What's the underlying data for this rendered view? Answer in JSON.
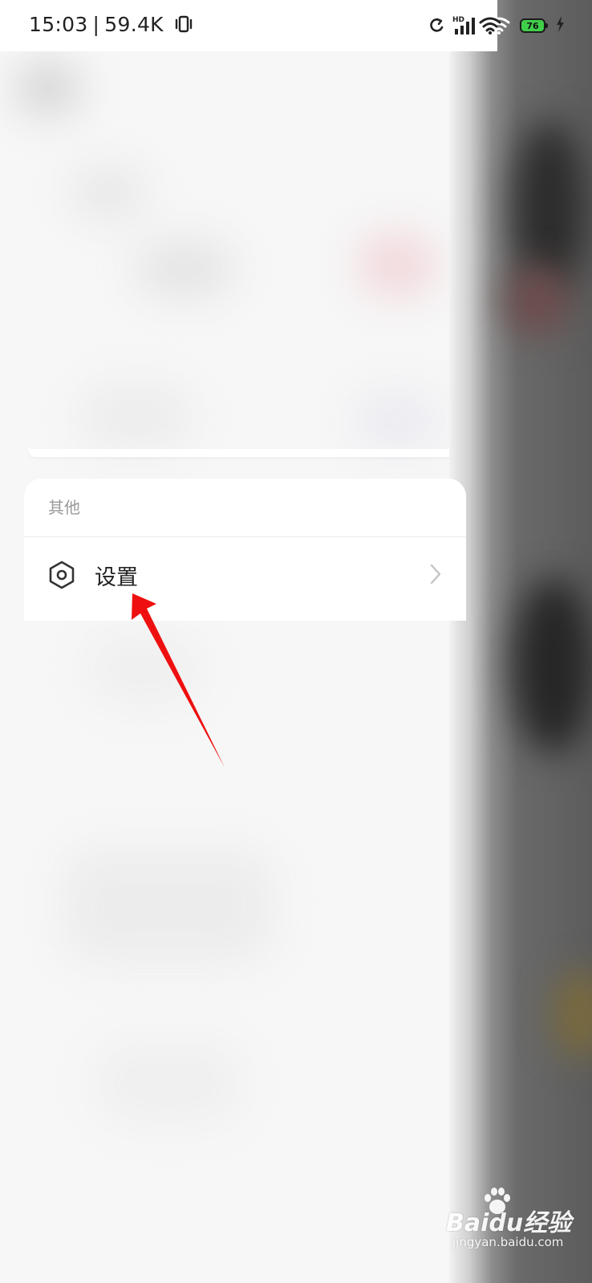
{
  "status_bar": {
    "time": "15:03",
    "separator": "|",
    "network_speed": "59.4K",
    "battery_level": "76",
    "icons": [
      "vibrate-icon",
      "sync-icon",
      "hd-signal-icon",
      "wifi-icon",
      "battery-icon",
      "charging-icon"
    ]
  },
  "section": {
    "header": "其他",
    "items": [
      {
        "label": "设置",
        "icon": "settings-hexagon-icon"
      }
    ]
  },
  "watermark": {
    "brand": "Baidu经验",
    "url": "jingyan.baidu.com"
  },
  "colors": {
    "arrow": "#ee1010",
    "battery": "#3fcf4a",
    "section_header": "#9a9a9a"
  }
}
